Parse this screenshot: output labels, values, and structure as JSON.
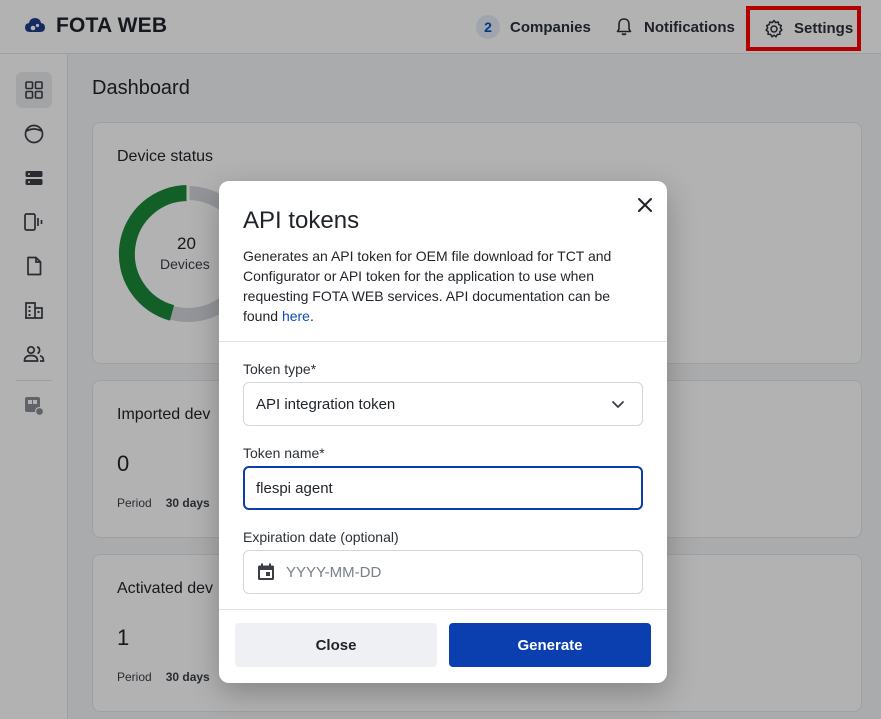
{
  "header": {
    "logo_text": "FOTA WEB",
    "companies_count": "2",
    "companies_label": "Companies",
    "notifications_label": "Notifications",
    "settings_label": "Settings"
  },
  "page": {
    "title": "Dashboard"
  },
  "cards": {
    "device_status": {
      "title": "Device status",
      "total": "20",
      "total_label": "Devices"
    },
    "imported": {
      "title": "Imported dev",
      "value": "0",
      "period_label": "Period",
      "period_value": "30 days"
    },
    "activated": {
      "title": "Activated dev",
      "value": "1",
      "period_label": "Period",
      "period_value": "30 days"
    }
  },
  "modal": {
    "title": "API tokens",
    "description": "Generates an API token for OEM file download for TCT and Configurator or API token for the application to use when requesting FOTA WEB services. API documentation can be found ",
    "link_text": "here",
    "after_link": ".",
    "token_type_label": "Token type*",
    "token_type_value": "API integration token",
    "token_name_label": "Token name*",
    "token_name_value": "flespi agent",
    "expiration_label": "Expiration date (optional)",
    "expiration_placeholder": "YYYY-MM-DD",
    "close_button": "Close",
    "generate_button": "Generate"
  },
  "colors": {
    "accent": "#0b3fb0",
    "donut_green": "#1a8a3a",
    "donut_gray": "#d3d6db",
    "highlight": "#ff0000"
  }
}
